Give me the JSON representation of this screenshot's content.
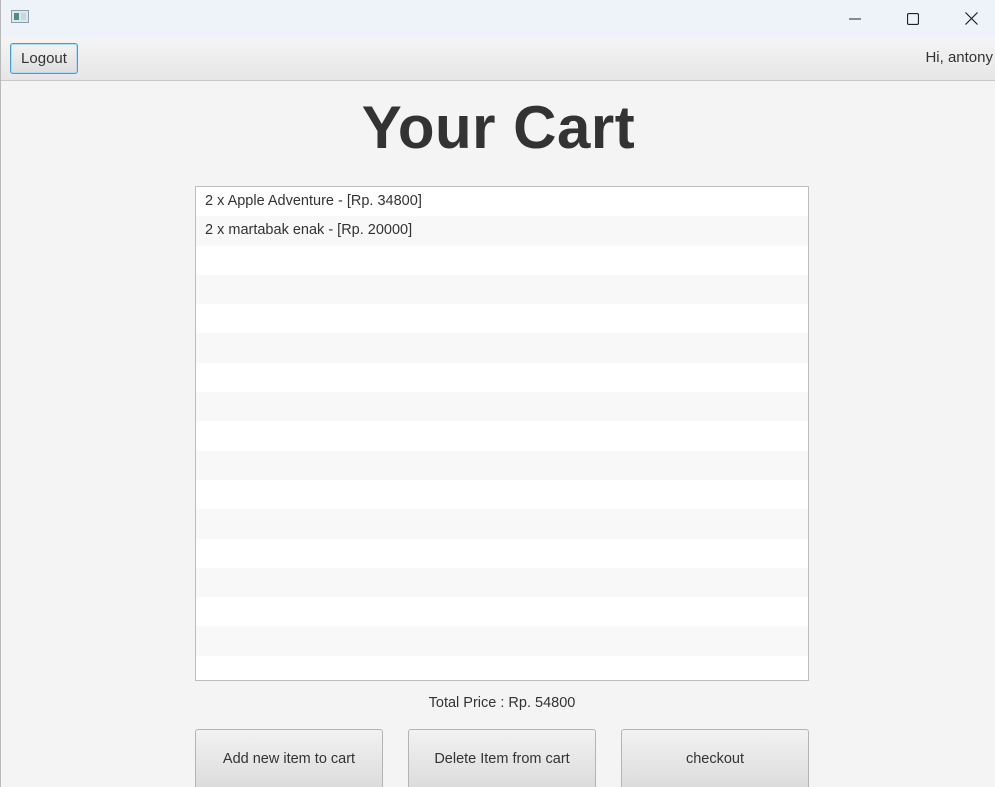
{
  "window": {
    "controls": {
      "minimize_icon": "minimize-icon",
      "maximize_icon": "maximize-icon",
      "close_icon": "close-icon"
    }
  },
  "topbar": {
    "logout_label": "Logout",
    "greeting": "Hi, antony"
  },
  "main": {
    "title": "Your Cart",
    "cart_items": [
      "2 x Apple Adventure - [Rp. 34800]",
      "2 x martabak enak - [Rp. 20000]"
    ],
    "total_price": "Total Price : Rp. 54800",
    "buttons": {
      "add": "Add new item to cart",
      "delete": "Delete Item from cart",
      "checkout": "checkout"
    }
  },
  "colors": {
    "focus_border": "#3c9fd8",
    "text": "#333333",
    "background": "#f4f4f4"
  }
}
